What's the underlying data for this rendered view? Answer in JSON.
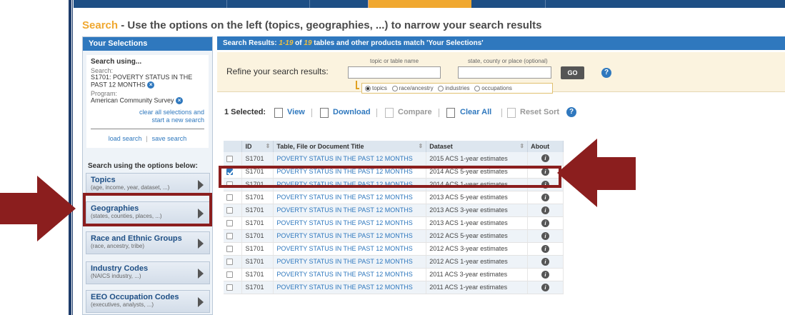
{
  "heading": {
    "accent": "Search",
    "rest": " - Use the options on the left (topics, geographies, ...) to narrow your search results"
  },
  "selections": {
    "header": "Your Selections",
    "search_using": "Search using...",
    "search_label": "Search:",
    "search_value": "S1701: POVERTY STATUS IN THE PAST 12 MONTHS",
    "program_label": "Program:",
    "program_value": "American Community Survey",
    "clear_line1": "clear all selections and",
    "clear_line2": "start a new search",
    "load": "load search",
    "save": "save search",
    "options_title": "Search using the options below:"
  },
  "options": [
    {
      "title": "Topics",
      "sub": "(age, income, year, dataset, ...)"
    },
    {
      "title": "Geographies",
      "sub": "(states, counties, places, ...)"
    },
    {
      "title": "Race and Ethnic Groups",
      "sub": "(race, ancestry, tribe)"
    },
    {
      "title": "Industry Codes",
      "sub": "(NAICS industry, ...)"
    },
    {
      "title": "EEO Occupation Codes",
      "sub": "(executives, analysts, ...)"
    }
  ],
  "results": {
    "head_prefix": "Search Results: ",
    "range": "1-19",
    "of": " of ",
    "total": "19",
    "head_suffix": " tables and other products match 'Your Selections'",
    "refine_label": "Refine your search results:",
    "topic_hint": "topic or table name",
    "geo_hint": "state, county or place (optional)",
    "go": "GO",
    "radios": [
      "topics",
      "race/ancestry",
      "industries",
      "occupations"
    ]
  },
  "toolbar": {
    "selected": "1 Selected:",
    "view": "View",
    "download": "Download",
    "compare": "Compare",
    "clear_all": "Clear All",
    "reset_sort": "Reset Sort"
  },
  "table": {
    "headers": [
      "ID",
      "Table, File or Document Title",
      "Dataset",
      "About"
    ],
    "rows": [
      {
        "id": "S1701",
        "title": "POVERTY STATUS IN THE PAST 12 MONTHS",
        "dataset": "2015 ACS 1-year estimates",
        "checked": false
      },
      {
        "id": "S1701",
        "title": "POVERTY STATUS IN THE PAST 12 MONTHS",
        "dataset": "2014 ACS 5-year estimates",
        "checked": true
      },
      {
        "id": "S1701",
        "title": "POVERTY STATUS IN THE PAST 12 MONTHS",
        "dataset": "2014 ACS 1-year estimates",
        "checked": false
      },
      {
        "id": "S1701",
        "title": "POVERTY STATUS IN THE PAST 12 MONTHS",
        "dataset": "2013 ACS 5-year estimates",
        "checked": false
      },
      {
        "id": "S1701",
        "title": "POVERTY STATUS IN THE PAST 12 MONTHS",
        "dataset": "2013 ACS 3-year estimates",
        "checked": false
      },
      {
        "id": "S1701",
        "title": "POVERTY STATUS IN THE PAST 12 MONTHS",
        "dataset": "2013 ACS 1-year estimates",
        "checked": false
      },
      {
        "id": "S1701",
        "title": "POVERTY STATUS IN THE PAST 12 MONTHS",
        "dataset": "2012 ACS 5-year estimates",
        "checked": false
      },
      {
        "id": "S1701",
        "title": "POVERTY STATUS IN THE PAST 12 MONTHS",
        "dataset": "2012 ACS 3-year estimates",
        "checked": false
      },
      {
        "id": "S1701",
        "title": "POVERTY STATUS IN THE PAST 12 MONTHS",
        "dataset": "2012 ACS 1-year estimates",
        "checked": false
      },
      {
        "id": "S1701",
        "title": "POVERTY STATUS IN THE PAST 12 MONTHS",
        "dataset": "2011 ACS 3-year estimates",
        "checked": false
      },
      {
        "id": "S1701",
        "title": "POVERTY STATUS IN THE PAST 12 MONTHS",
        "dataset": "2011 ACS 1-year estimates",
        "checked": false
      }
    ]
  },
  "colors": {
    "brand": "#2f78be",
    "accent": "#f0a830",
    "annotation": "#8b1e1e"
  }
}
